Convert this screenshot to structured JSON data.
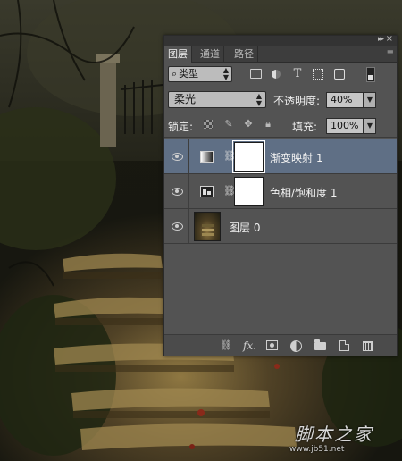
{
  "panel": {
    "tabs": [
      {
        "label": "图层",
        "active": true
      },
      {
        "label": "通道",
        "active": false
      },
      {
        "label": "路径",
        "active": false
      }
    ],
    "filter": {
      "value": "类型",
      "icons": [
        "image-filter-icon",
        "adjustment-filter-icon",
        "type-filter-icon",
        "shape-filter-icon",
        "smart-object-filter-icon"
      ]
    },
    "blend_mode": "柔光",
    "opacity_label": "不透明度:",
    "opacity_value": "40%",
    "lock_label": "锁定:",
    "fill_label": "填充:",
    "fill_value": "100%",
    "layers": [
      {
        "name": "渐变映射 1",
        "type": "gradient-map",
        "selected": true,
        "visible": true
      },
      {
        "name": "色相/饱和度 1",
        "type": "hue-saturation",
        "selected": false,
        "visible": true
      },
      {
        "name": "图层 0",
        "type": "pixel",
        "selected": false,
        "visible": true
      }
    ],
    "selected_color": "#5f6f85",
    "panel_color": "#535353"
  },
  "watermark": {
    "text": "脚本之家",
    "sub": "www.jb51.net"
  }
}
